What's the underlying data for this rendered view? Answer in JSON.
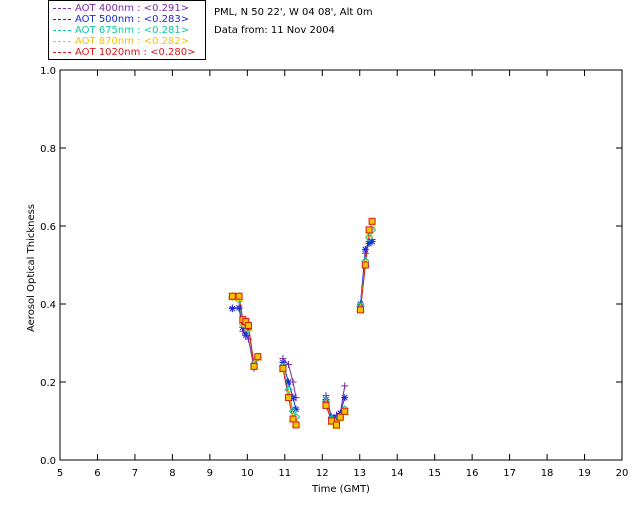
{
  "header": {
    "station": "PML, N 50 22', W 04 08', Alt 0m",
    "date": "Data from: 11 Nov 2004"
  },
  "legend": [
    {
      "label": "AOT  400nm : <0.291>",
      "color": "#7a2aa0"
    },
    {
      "label": "AOT  500nm : <0.283>",
      "color": "#1a2ad8"
    },
    {
      "label": "AOT  675nm : <0.281>",
      "color": "#13c7a0"
    },
    {
      "label": "AOT  870nm : <0.282>",
      "color": "#f5c400"
    },
    {
      "label": "AOT 1020nm : <0.280>",
      "color": "#d81818"
    }
  ],
  "chart_data": {
    "type": "line",
    "xlabel": "Time (GMT)",
    "ylabel": "Aerosol Optical Thickness",
    "xlim": [
      5,
      20
    ],
    "ylim": [
      0.0,
      1.0
    ],
    "xticks": [
      5,
      6,
      7,
      8,
      9,
      10,
      11,
      12,
      13,
      14,
      15,
      16,
      17,
      18,
      19,
      20
    ],
    "yticks": [
      0.0,
      0.2,
      0.4,
      0.6,
      0.8,
      1.0
    ],
    "grid": false,
    "legend_position": "top-left, outside plot",
    "series": [
      {
        "name": "AOT  400nm : <0.291>",
        "color": "#7a2aa0",
        "marker": "plus",
        "segments": [
          [
            [
              9.6,
              0.39
            ],
            [
              9.78,
              0.39
            ],
            [
              9.88,
              0.33
            ],
            [
              9.96,
              0.32
            ],
            [
              10.03,
              0.31
            ],
            [
              10.18,
              0.235
            ],
            [
              10.28,
              0.265
            ]
          ],
          [
            [
              10.95,
              0.26
            ],
            [
              11.1,
              0.245
            ],
            [
              11.22,
              0.2
            ],
            [
              11.3,
              0.16
            ]
          ],
          [
            [
              12.1,
              0.165
            ],
            [
              12.25,
              0.11
            ],
            [
              12.38,
              0.115
            ],
            [
              12.48,
              0.12
            ],
            [
              12.6,
              0.19
            ]
          ],
          [
            [
              13.02,
              0.4
            ],
            [
              13.15,
              0.53
            ],
            [
              13.25,
              0.56
            ],
            [
              13.33,
              0.565
            ]
          ]
        ]
      },
      {
        "name": "AOT  500nm : <0.283>",
        "color": "#1a2ad8",
        "marker": "star",
        "segments": [
          [
            [
              9.6,
              0.388
            ],
            [
              9.78,
              0.39
            ],
            [
              9.88,
              0.34
            ],
            [
              9.96,
              0.32
            ],
            [
              10.03,
              0.34
            ],
            [
              10.18,
              0.245
            ],
            [
              10.28,
              0.262
            ]
          ],
          [
            [
              10.95,
              0.25
            ],
            [
              11.1,
              0.2
            ],
            [
              11.22,
              0.16
            ],
            [
              11.3,
              0.13
            ]
          ],
          [
            [
              12.1,
              0.155
            ],
            [
              12.25,
              0.11
            ],
            [
              12.38,
              0.11
            ],
            [
              12.48,
              0.12
            ],
            [
              12.6,
              0.16
            ]
          ],
          [
            [
              13.02,
              0.4
            ],
            [
              13.15,
              0.54
            ],
            [
              13.25,
              0.555
            ],
            [
              13.33,
              0.56
            ]
          ]
        ]
      },
      {
        "name": "AOT  675nm : <0.281>",
        "color": "#13c7a0",
        "marker": "diamond",
        "segments": [
          [
            [
              9.6,
              0.418
            ],
            [
              9.78,
              0.41
            ],
            [
              9.88,
              0.35
            ],
            [
              9.96,
              0.345
            ],
            [
              10.03,
              0.335
            ],
            [
              10.18,
              0.245
            ],
            [
              10.28,
              0.262
            ]
          ],
          [
            [
              10.95,
              0.24
            ],
            [
              11.1,
              0.18
            ],
            [
              11.22,
              0.125
            ],
            [
              11.3,
              0.11
            ]
          ],
          [
            [
              12.1,
              0.15
            ],
            [
              12.25,
              0.105
            ],
            [
              12.38,
              0.1
            ],
            [
              12.48,
              0.11
            ],
            [
              12.6,
              0.13
            ]
          ],
          [
            [
              13.02,
              0.395
            ],
            [
              13.15,
              0.51
            ],
            [
              13.25,
              0.57
            ],
            [
              13.33,
              0.59
            ]
          ]
        ]
      },
      {
        "name": "AOT  870nm : <0.282>",
        "color": "#f5c400",
        "marker": "triangle",
        "segments": [
          [
            [
              9.6,
              0.42
            ],
            [
              9.78,
              0.418
            ],
            [
              9.88,
              0.355
            ],
            [
              9.96,
              0.35
            ],
            [
              10.03,
              0.34
            ],
            [
              10.18,
              0.245
            ],
            [
              10.28,
              0.265
            ]
          ],
          [
            [
              10.95,
              0.235
            ],
            [
              11.1,
              0.17
            ],
            [
              11.22,
              0.11
            ],
            [
              11.3,
              0.095
            ]
          ],
          [
            [
              12.1,
              0.145
            ],
            [
              12.25,
              0.1
            ],
            [
              12.38,
              0.09
            ],
            [
              12.48,
              0.11
            ],
            [
              12.6,
              0.125
            ]
          ],
          [
            [
              13.02,
              0.39
            ],
            [
              13.15,
              0.505
            ],
            [
              13.25,
              0.58
            ],
            [
              13.33,
              0.6
            ]
          ]
        ]
      },
      {
        "name": "AOT 1020nm : <0.280>",
        "color": "#d81818",
        "marker": "square",
        "segments": [
          [
            [
              9.6,
              0.42
            ],
            [
              9.78,
              0.42
            ],
            [
              9.88,
              0.36
            ],
            [
              9.96,
              0.355
            ],
            [
              10.03,
              0.345
            ],
            [
              10.18,
              0.24
            ],
            [
              10.28,
              0.265
            ]
          ],
          [
            [
              10.95,
              0.235
            ],
            [
              11.1,
              0.16
            ],
            [
              11.22,
              0.105
            ],
            [
              11.3,
              0.09
            ]
          ],
          [
            [
              12.1,
              0.14
            ],
            [
              12.25,
              0.1
            ],
            [
              12.38,
              0.09
            ],
            [
              12.48,
              0.11
            ],
            [
              12.6,
              0.125
            ]
          ],
          [
            [
              13.02,
              0.385
            ],
            [
              13.15,
              0.5
            ],
            [
              13.25,
              0.59
            ],
            [
              13.33,
              0.612
            ]
          ]
        ]
      }
    ]
  }
}
